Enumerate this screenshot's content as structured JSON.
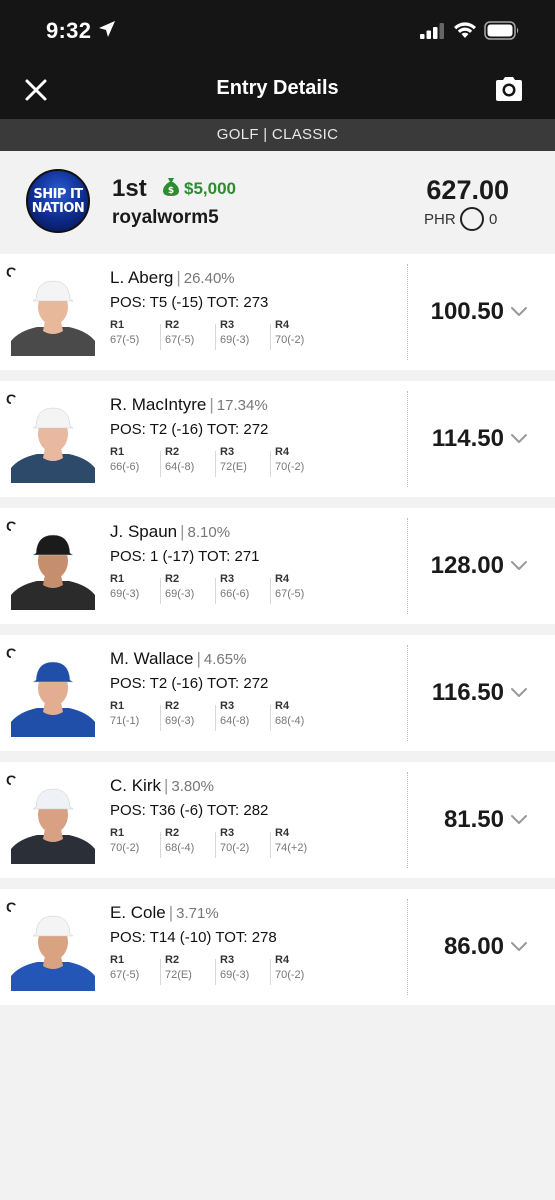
{
  "status_bar": {
    "time": "9:32"
  },
  "header": {
    "title": "Entry Details"
  },
  "contest_type": "GOLF | CLASSIC",
  "entry": {
    "logo_text_line1": "SHIP IT",
    "logo_text_line2": "NATION",
    "rank": "1st",
    "prize": "$5,000",
    "username": "royalworm5",
    "total_points": "627.00",
    "phr_label": "PHR",
    "phr_value": "0"
  },
  "colors": {
    "prize_green": "#2e8b2e",
    "header_bg": "#151515",
    "subheader_bg": "#3a3a3a"
  },
  "players": [
    {
      "pos": "G",
      "name": "L. Aberg",
      "ownership": "26.40%",
      "position_line": "POS: T5 (-15) TOT: 273",
      "rounds": [
        {
          "label": "R1",
          "value": "67(-5)"
        },
        {
          "label": "R2",
          "value": "67(-5)"
        },
        {
          "label": "R3",
          "value": "69(-3)"
        },
        {
          "label": "R4",
          "value": "70(-2)"
        }
      ],
      "points": "100.50",
      "shirt": "#4a4a4a",
      "cap": "#f4f4f4",
      "skin": "#e8b89a"
    },
    {
      "pos": "G",
      "name": "R. MacIntyre",
      "ownership": "17.34%",
      "position_line": "POS: T2 (-16) TOT: 272",
      "rounds": [
        {
          "label": "R1",
          "value": "66(-6)"
        },
        {
          "label": "R2",
          "value": "64(-8)"
        },
        {
          "label": "R3",
          "value": "72(E)"
        },
        {
          "label": "R4",
          "value": "70(-2)"
        }
      ],
      "points": "114.50",
      "shirt": "#2d4a6a",
      "cap": "#f4f4f4",
      "skin": "#e9b8a0"
    },
    {
      "pos": "G",
      "name": "J. Spaun",
      "ownership": "8.10%",
      "position_line": "POS: 1 (-17) TOT: 271",
      "rounds": [
        {
          "label": "R1",
          "value": "69(-3)"
        },
        {
          "label": "R2",
          "value": "69(-3)"
        },
        {
          "label": "R3",
          "value": "66(-6)"
        },
        {
          "label": "R4",
          "value": "67(-5)"
        }
      ],
      "points": "128.00",
      "shirt": "#2b2b2b",
      "cap": "#1b1b1b",
      "skin": "#c58f6e"
    },
    {
      "pos": "G",
      "name": "M. Wallace",
      "ownership": "4.65%",
      "position_line": "POS: T2 (-16) TOT: 272",
      "rounds": [
        {
          "label": "R1",
          "value": "71(-1)"
        },
        {
          "label": "R2",
          "value": "69(-3)"
        },
        {
          "label": "R3",
          "value": "64(-8)"
        },
        {
          "label": "R4",
          "value": "68(-4)"
        }
      ],
      "points": "116.50",
      "shirt": "#1f4fa8",
      "cap": "#1f4fa8",
      "skin": "#e3ad92"
    },
    {
      "pos": "G",
      "name": "C. Kirk",
      "ownership": "3.80%",
      "position_line": "POS: T36 (-6) TOT: 282",
      "rounds": [
        {
          "label": "R1",
          "value": "70(-2)"
        },
        {
          "label": "R2",
          "value": "68(-4)"
        },
        {
          "label": "R3",
          "value": "70(-2)"
        },
        {
          "label": "R4",
          "value": "74(+2)"
        }
      ],
      "points": "81.50",
      "shirt": "#2a2f38",
      "cap": "#eef2f6",
      "skin": "#d8a184"
    },
    {
      "pos": "G",
      "name": "E. Cole",
      "ownership": "3.71%",
      "position_line": "POS: T14 (-10) TOT: 278",
      "rounds": [
        {
          "label": "R1",
          "value": "67(-5)"
        },
        {
          "label": "R2",
          "value": "72(E)"
        },
        {
          "label": "R3",
          "value": "69(-3)"
        },
        {
          "label": "R4",
          "value": "70(-2)"
        }
      ],
      "points": "86.00",
      "shirt": "#2456b8",
      "cap": "#f4f4f4",
      "skin": "#d9a382"
    }
  ]
}
